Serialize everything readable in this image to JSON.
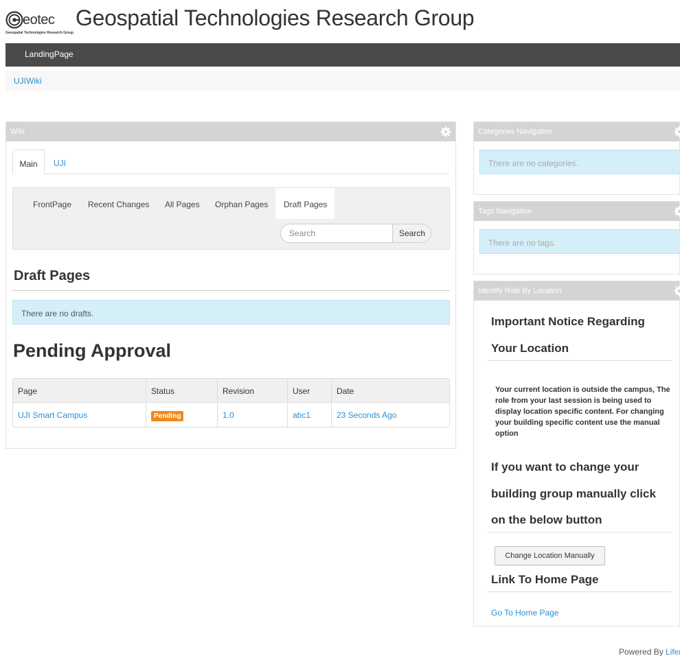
{
  "header": {
    "logo_text": "eotec",
    "logo_subtext": "Geospatial Technologies Research Group",
    "site_title": "Geospatial Technologies Research Group"
  },
  "navbar": {
    "items": [
      {
        "label": "LandingPage"
      }
    ]
  },
  "breadcrumb": {
    "items": [
      {
        "label": "UJIWiki"
      }
    ]
  },
  "wiki": {
    "title": "Wiki",
    "tabs": [
      {
        "label": "Main",
        "active": true
      },
      {
        "label": "UJI",
        "active": false
      }
    ],
    "nav": [
      {
        "label": "FrontPage"
      },
      {
        "label": "Recent Changes"
      },
      {
        "label": "All Pages"
      },
      {
        "label": "Orphan Pages"
      },
      {
        "label": "Draft Pages",
        "active": true
      }
    ],
    "search": {
      "placeholder": "Search",
      "button_label": "Search"
    },
    "draft_heading": "Draft Pages",
    "draft_empty": "There are no drafts.",
    "pending_heading": "Pending Approval",
    "table": {
      "headers": [
        "Page",
        "Status",
        "Revision",
        "User",
        "Date"
      ],
      "rows": [
        {
          "page": "UJI Smart Campus",
          "status": "Pending",
          "revision": "1.0",
          "user": "abc1",
          "date": "23 Seconds Ago"
        }
      ]
    }
  },
  "categories": {
    "title": "Categories Navigation",
    "empty": "There are no categories."
  },
  "tags": {
    "title": "Tags Navigation",
    "empty": "There are no tags."
  },
  "identify_role": {
    "title": "Identify Role By Location",
    "notice_line1": "Important Notice Regarding",
    "notice_line2": "Your Location",
    "body": "Your current location is outside the campus, The role from your last session is being used to display location specific content. For changing your building specific content use the manual option",
    "change_line1": "If you want to change your",
    "change_line2": "building group manually click",
    "change_line3": "on the below button",
    "button_label": "Change Location Manually",
    "home_heading": "Link To Home Page",
    "home_link": "Go To Home Page"
  },
  "footer": {
    "powered_by": "Powered By",
    "link": "Lifer"
  },
  "colors": {
    "navbar": "#4a4a4a",
    "portlet_header": "#d4d4d4",
    "link": "#2a8fd6",
    "info_alert": "#d5eff9",
    "pending_badge": "#ee8a1a"
  }
}
